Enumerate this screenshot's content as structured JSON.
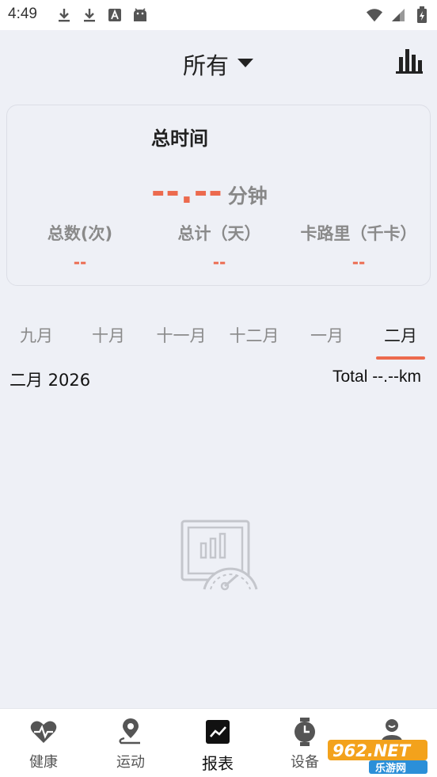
{
  "status_bar": {
    "time": "4:49"
  },
  "header": {
    "title": "所有"
  },
  "summary": {
    "title": "总时间",
    "total_time_value": "--.--",
    "total_time_unit": "分钟",
    "stats": [
      {
        "label": "总数(次)",
        "value": "--"
      },
      {
        "label": "总计（天）",
        "value": "--"
      },
      {
        "label": "卡路里（千卡）",
        "value": "--"
      }
    ]
  },
  "months": {
    "tabs": [
      "九月",
      "十月",
      "十一月",
      "十二月",
      "一月",
      "二月"
    ],
    "active_index": 5
  },
  "period": {
    "label": "二月 2026",
    "total": "Total --.--km"
  },
  "bottom_nav": {
    "items": [
      {
        "label": "健康",
        "icon": "heart-pulse-icon"
      },
      {
        "label": "运动",
        "icon": "location-pin-icon"
      },
      {
        "label": "报表",
        "icon": "report-chart-icon"
      },
      {
        "label": "设备",
        "icon": "watch-icon"
      },
      {
        "label": "",
        "icon": "profile-icon"
      }
    ],
    "active_index": 2
  },
  "watermark": {
    "text": "962.NET",
    "sub": "乐游网"
  },
  "colors": {
    "accent": "#ec6a4e",
    "background": "#eef0f6"
  }
}
